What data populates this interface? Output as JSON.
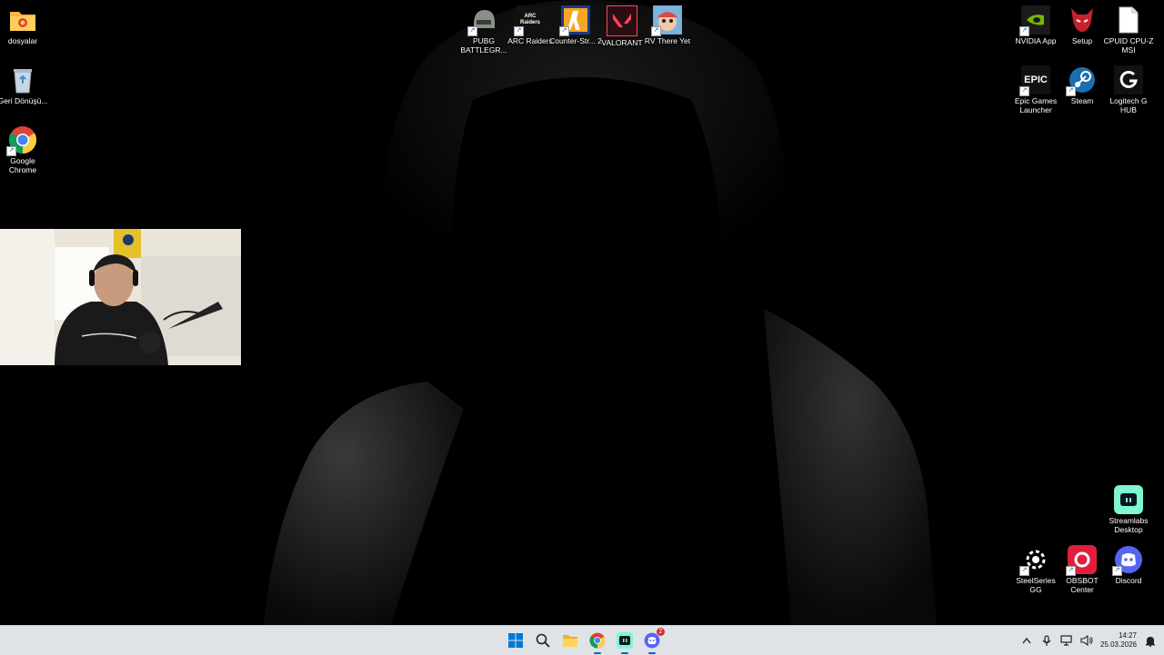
{
  "desktop": {
    "left_icons": [
      {
        "label": "dosyalar"
      },
      {
        "label": "Geri Dönüşü..."
      },
      {
        "label": "Google Chrome"
      }
    ],
    "top_icons": [
      {
        "label": "PUBG BATTLEGR..."
      },
      {
        "label": "ARC Raiders",
        "logo_text": "ARC Raiders"
      },
      {
        "label": "Counter-Str... 2"
      },
      {
        "label": "VALORANT"
      },
      {
        "label": "RV There Yet"
      }
    ],
    "right_icons": [
      {
        "label": "NVIDIA App"
      },
      {
        "label": "Setup"
      },
      {
        "label": "CPUID CPU-Z MSI"
      },
      {
        "label": "Epic Games Launcher",
        "logo_text": "EPIC"
      },
      {
        "label": "Steam"
      },
      {
        "label": "Logitech G HUB"
      },
      {
        "label": "Streamlabs Desktop"
      },
      {
        "label": "SteelSeries GG"
      },
      {
        "label": "OBSBOT Center"
      },
      {
        "label": "Discord"
      }
    ]
  },
  "taskbar": {
    "apps": [
      "start-icon",
      "search-icon",
      "file-explorer-icon",
      "chrome-icon",
      "streamlabs-icon",
      "discord-icon"
    ],
    "discord_badge": "2",
    "clock": {
      "time": "14:27",
      "date": "25.03.2026"
    }
  },
  "colors": {
    "accent": "#0067c0",
    "taskbar": "#dfe3e8"
  }
}
